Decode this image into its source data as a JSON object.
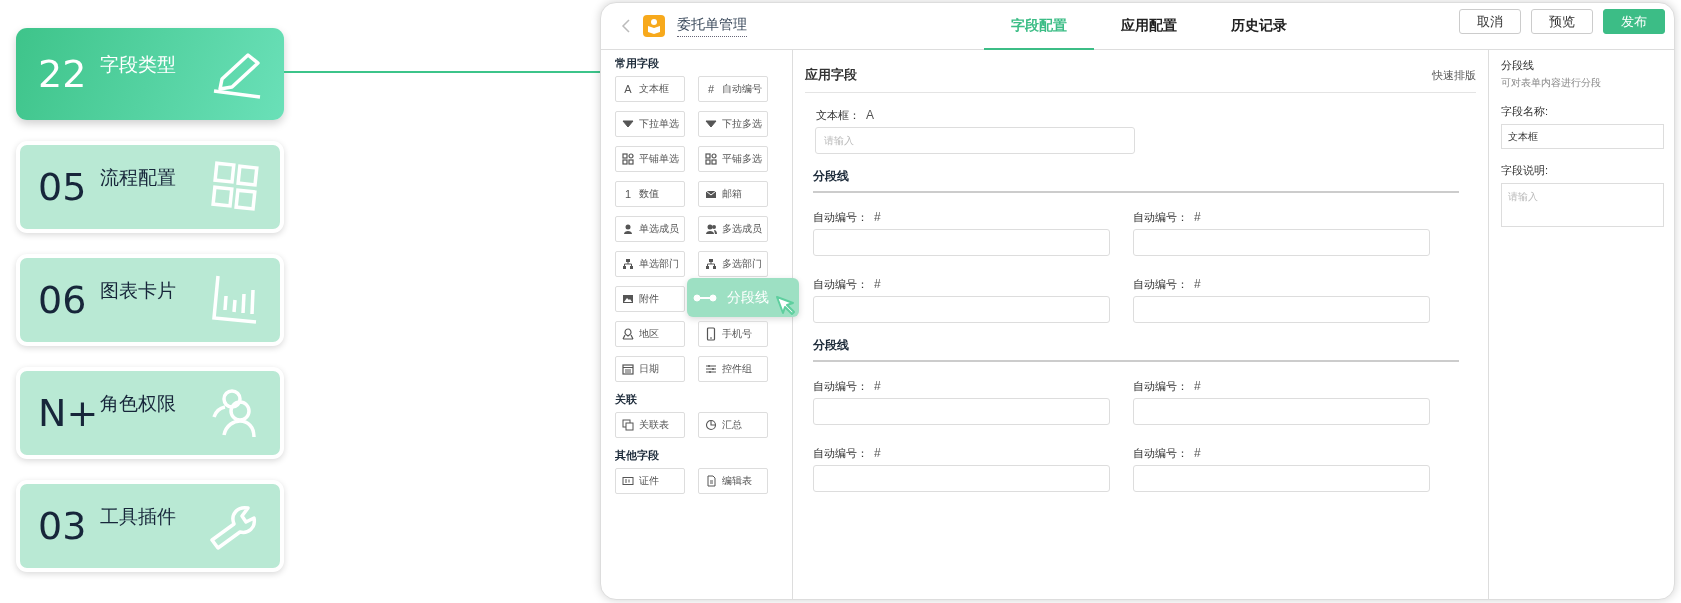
{
  "cards": [
    {
      "number": "22",
      "label": "字段类型",
      "selected": true
    },
    {
      "number": "05",
      "label": "流程配置",
      "selected": false
    },
    {
      "number": "06",
      "label": "图表卡片",
      "selected": false
    },
    {
      "number": "N+",
      "label": "角色权限",
      "selected": false
    },
    {
      "number": "03",
      "label": "工具插件",
      "selected": false
    }
  ],
  "window": {
    "title": "委托单管理",
    "tabs": [
      {
        "label": "字段配置",
        "selected": true
      },
      {
        "label": "应用配置",
        "selected": false
      },
      {
        "label": "历史记录",
        "selected": false
      }
    ],
    "buttons": [
      {
        "label": "取消",
        "kind": "default"
      },
      {
        "label": "预览",
        "kind": "default"
      },
      {
        "label": "发布",
        "kind": "primary"
      }
    ]
  },
  "palette": {
    "sections": [
      {
        "title": "常用字段",
        "items": [
          {
            "kind": "field",
            "label": "文本框",
            "glyph": "A"
          },
          {
            "kind": "field",
            "label": "自动编号",
            "glyph": "#"
          },
          {
            "kind": "field",
            "label": "下拉单选"
          },
          {
            "kind": "field",
            "label": "下拉多选"
          },
          {
            "kind": "field",
            "label": "平铺单选"
          },
          {
            "kind": "field",
            "label": "平铺多选"
          },
          {
            "kind": "field",
            "label": "数值",
            "glyph": "1"
          },
          {
            "kind": "field",
            "label": "邮箱"
          },
          {
            "kind": "field",
            "label": "单选成员"
          },
          {
            "kind": "field",
            "label": "多选成员"
          },
          {
            "kind": "field",
            "label": "单选部门"
          },
          {
            "kind": "field",
            "label": "多选部门"
          },
          {
            "kind": "field",
            "label": "附件"
          },
          {
            "kind": "dragging",
            "label": "分段线"
          },
          {
            "kind": "field",
            "label": "地区"
          },
          {
            "kind": "field",
            "label": "手机号"
          },
          {
            "kind": "field",
            "label": "日期"
          },
          {
            "kind": "field",
            "label": "控件组"
          }
        ]
      },
      {
        "title": "关联",
        "items": [
          {
            "kind": "field",
            "label": "关联表"
          },
          {
            "kind": "field",
            "label": "汇总"
          }
        ]
      },
      {
        "title": "其他字段",
        "items": [
          {
            "kind": "field",
            "label": "证件"
          },
          {
            "kind": "field",
            "label": "编辑表"
          }
        ]
      }
    ]
  },
  "form": {
    "title": "应用字段",
    "action": "快速排版",
    "rows": [
      {
        "kind": "single",
        "fields": [
          {
            "label": "文本框：",
            "marker": "A",
            "placeholder": "请输入"
          }
        ]
      },
      {
        "kind": "divider",
        "title": "分段线"
      },
      {
        "kind": "pair",
        "fields": [
          {
            "label": "自动编号：",
            "marker": "#"
          },
          {
            "label": "自动编号：",
            "marker": "#"
          }
        ]
      },
      {
        "kind": "pair",
        "fields": [
          {
            "label": "自动编号：",
            "marker": "#"
          },
          {
            "label": "自动编号：",
            "marker": "#"
          }
        ]
      },
      {
        "kind": "divider",
        "title": "分段线"
      },
      {
        "kind": "pair",
        "fields": [
          {
            "label": "自动编号：",
            "marker": "#"
          },
          {
            "label": "自动编号：",
            "marker": "#"
          }
        ]
      },
      {
        "kind": "pair",
        "fields": [
          {
            "label": "自动编号：",
            "marker": "#"
          },
          {
            "label": "自动编号：",
            "marker": "#"
          }
        ]
      }
    ]
  },
  "properties": {
    "title": "分段线",
    "hint": "可对表单内容进行分段",
    "fields": [
      {
        "kind": "input",
        "label": "字段名称:",
        "value": "文本框"
      },
      {
        "kind": "textarea",
        "label": "字段说明:",
        "placeholder": "请输入"
      }
    ]
  }
}
